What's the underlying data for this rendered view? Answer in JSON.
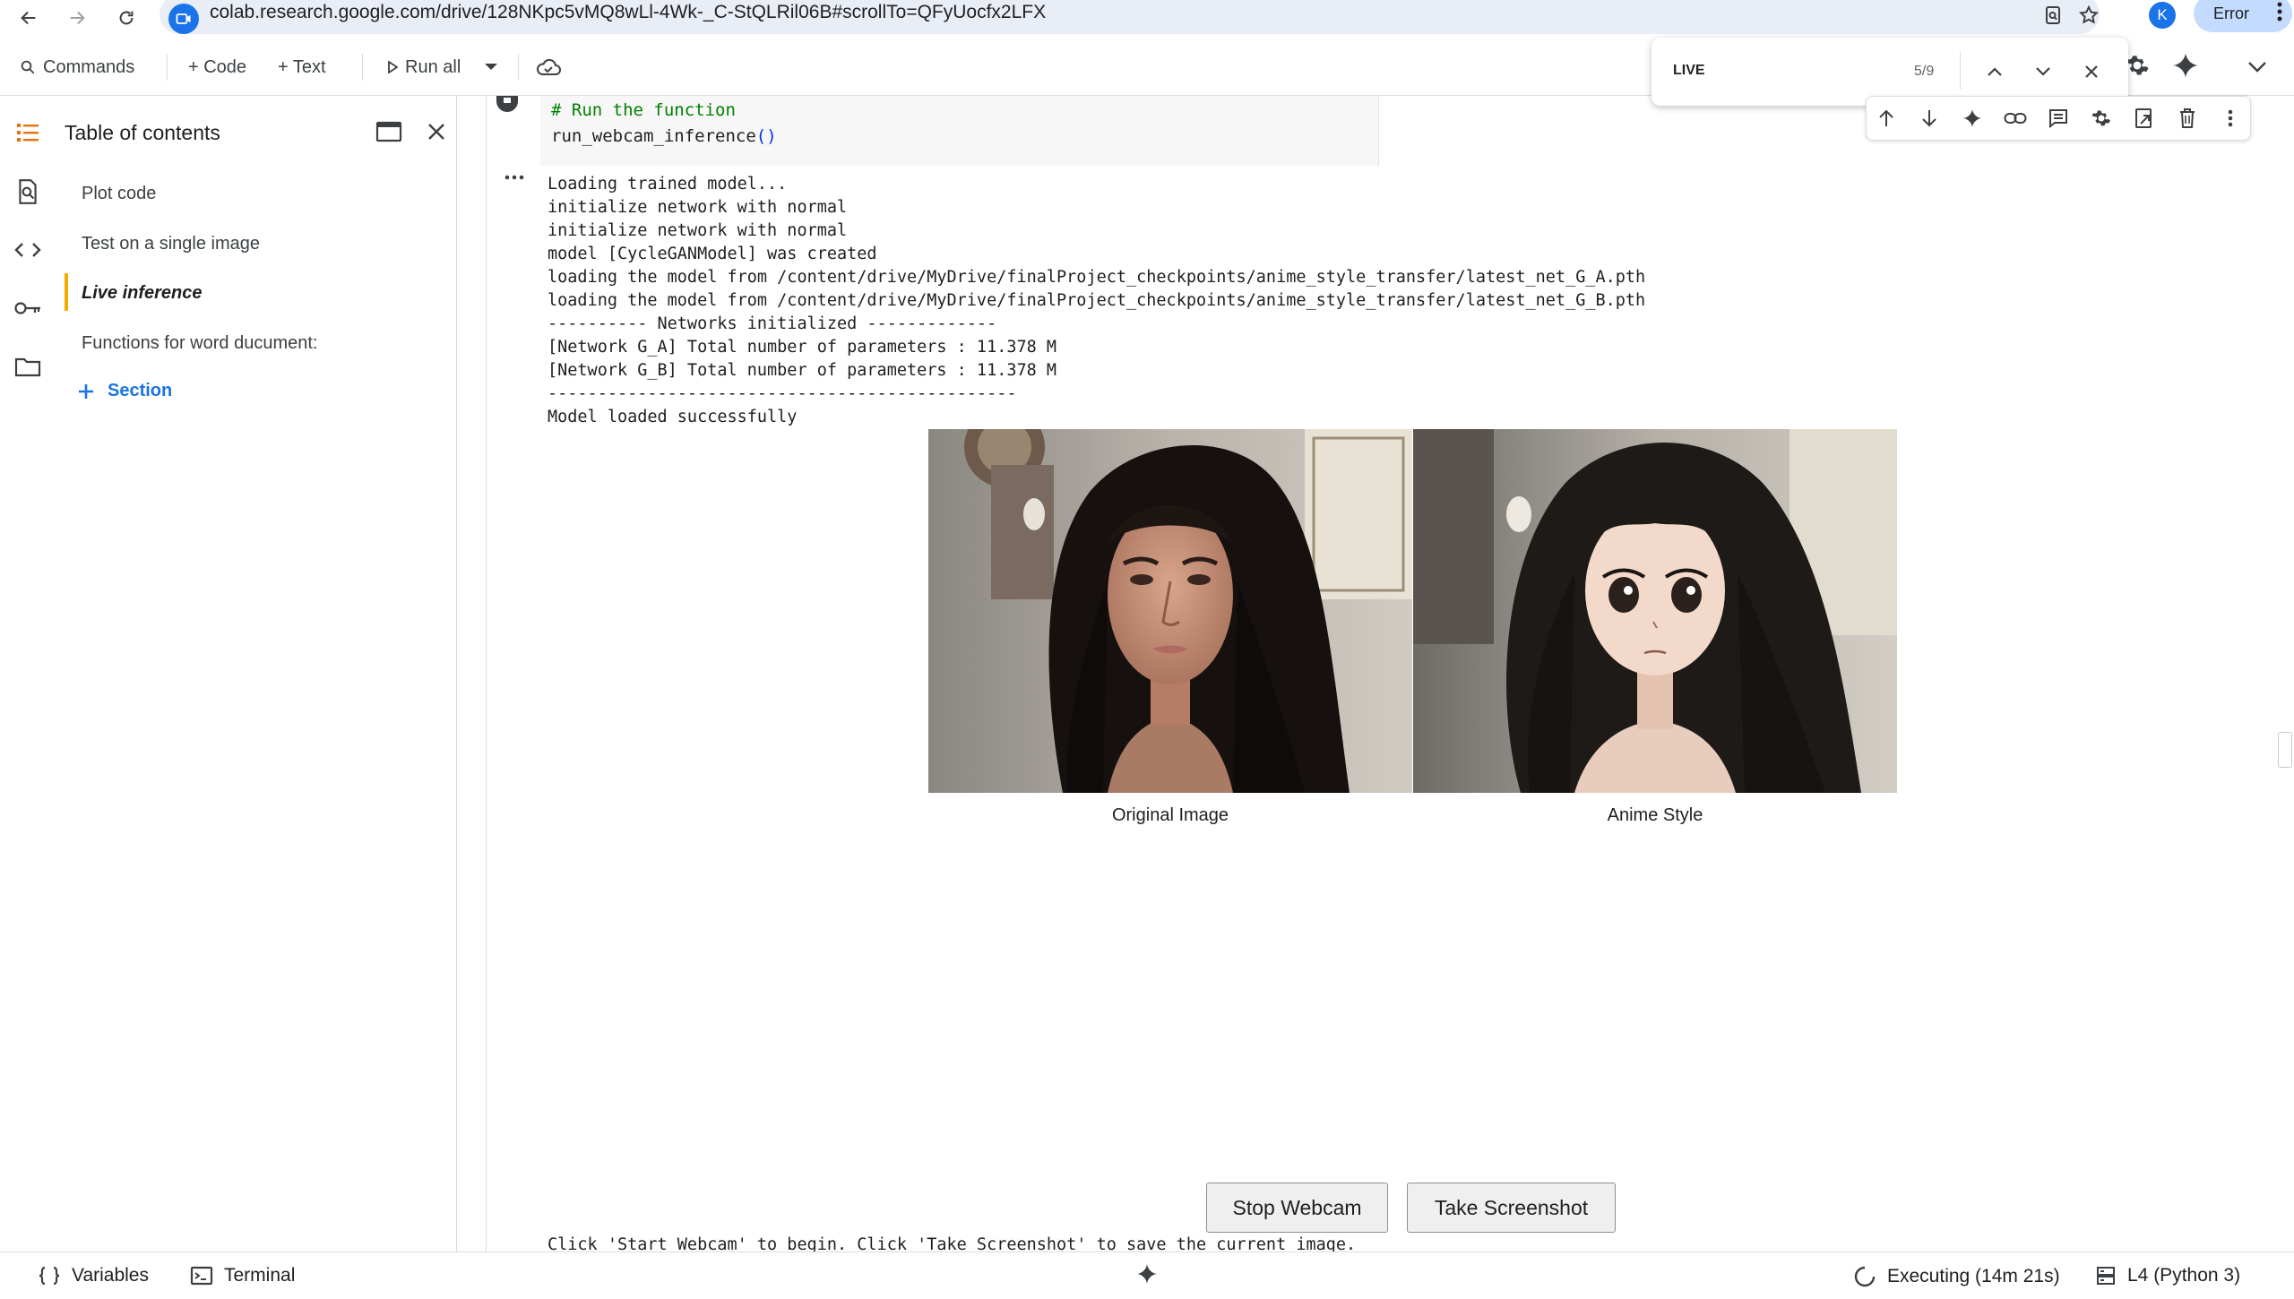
{
  "browser": {
    "url": "colab.research.google.com/drive/128NKpc5vMQ8wLl-4Wk-_C-StQLRil06B#scrollTo=QFyUocfx2LFX",
    "profile_initial": "K",
    "error_label": "Error"
  },
  "toolbar": {
    "commands_label": "Commands",
    "code_label": "+ Code",
    "text_label": "+ Text",
    "run_all_label": "Run all"
  },
  "find": {
    "query": "LIVE",
    "count": "5/9"
  },
  "toc": {
    "title": "Table of contents",
    "items": [
      {
        "label": "Plot code"
      },
      {
        "label": "Test on a single image"
      },
      {
        "label": "Live inference"
      },
      {
        "label": "Functions for word ducument:"
      }
    ],
    "add_section_label": "Section"
  },
  "cell": {
    "comment": "# Run the function",
    "call_name": "run_webcam_inference",
    "call_parens": "()"
  },
  "output": {
    "lines": [
      "Loading trained model...",
      "initialize network with normal",
      "initialize network with normal",
      "model [CycleGANModel] was created",
      "loading the model from /content/drive/MyDrive/finalProject_checkpoints/anime_style_transfer/latest_net_G_A.pth",
      "loading the model from /content/drive/MyDrive/finalProject_checkpoints/anime_style_transfer/latest_net_G_B.pth",
      "---------- Networks initialized -------------",
      "[Network G_A] Total number of parameters : 11.378 M",
      "[Network G_B] Total number of parameters : 11.378 M",
      "-----------------------------------------------",
      "Model loaded successfully"
    ],
    "caption_original": "Original Image",
    "caption_anime": "Anime Style",
    "stop_button": "Stop Webcam",
    "screenshot_button": "Take Screenshot",
    "footer": "Click 'Start Webcam' to begin. Click 'Take Screenshot' to save the current image."
  },
  "status": {
    "variables_label": "Variables",
    "terminal_label": "Terminal",
    "executing_label": "Executing (14m 21s)",
    "runtime_label": "L4 (Python 3)"
  },
  "colors": {
    "accent_orange": "#f9ab00",
    "link_blue": "#1a73e8",
    "code_comment": "#008000"
  }
}
